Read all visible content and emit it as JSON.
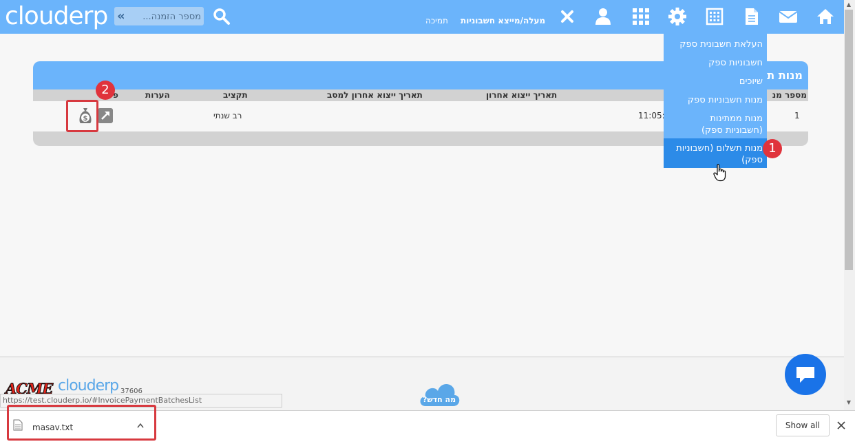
{
  "topbar": {
    "logo": "clouderp",
    "search_placeholder": "מספר הזמנה...",
    "nav_upload_export": "מעלה/מייצא חשבוניות",
    "nav_support": "תמיכה"
  },
  "dropdown": {
    "items": [
      {
        "label": "העלאת חשבונית ספק"
      },
      {
        "label": "חשבוניות ספק"
      },
      {
        "label": "שיוכים"
      },
      {
        "label": "מנות חשבוניות ספק"
      },
      {
        "label": "מנות ממתינות (חשבוניות ספק)"
      },
      {
        "label": "מנות תשלום (חשבוניות ספק)"
      }
    ],
    "active_index": 5
  },
  "panel": {
    "title": "מנות ת",
    "columns": {
      "batch_no": "מספר מנ",
      "last_export_date": "תאריך ייצוא אחרון",
      "last_export_date_masav": "תאריך ייצוא אחרון למסב",
      "budget": "תקציב",
      "notes": "הערות",
      "actions": "פ"
    },
    "rows": [
      {
        "batch_no": "1",
        "time": "11:05:",
        "budget": "רב שנתי",
        "notes": ""
      }
    ]
  },
  "badges": {
    "one": "1",
    "two": "2"
  },
  "footer": {
    "acme": "ACME",
    "clouderp": "clouderp",
    "version": "37606",
    "whats_new": "מה חדש?",
    "status_url": "https://test.clouderp.io/#InvoicePaymentBatchesList"
  },
  "download": {
    "filename": "masav.txt",
    "show_all": "Show all"
  },
  "colors": {
    "topbar": "#6bb4fb",
    "active_item": "#2c8be8",
    "badge": "#e0333c",
    "chat": "#1a73e8"
  }
}
